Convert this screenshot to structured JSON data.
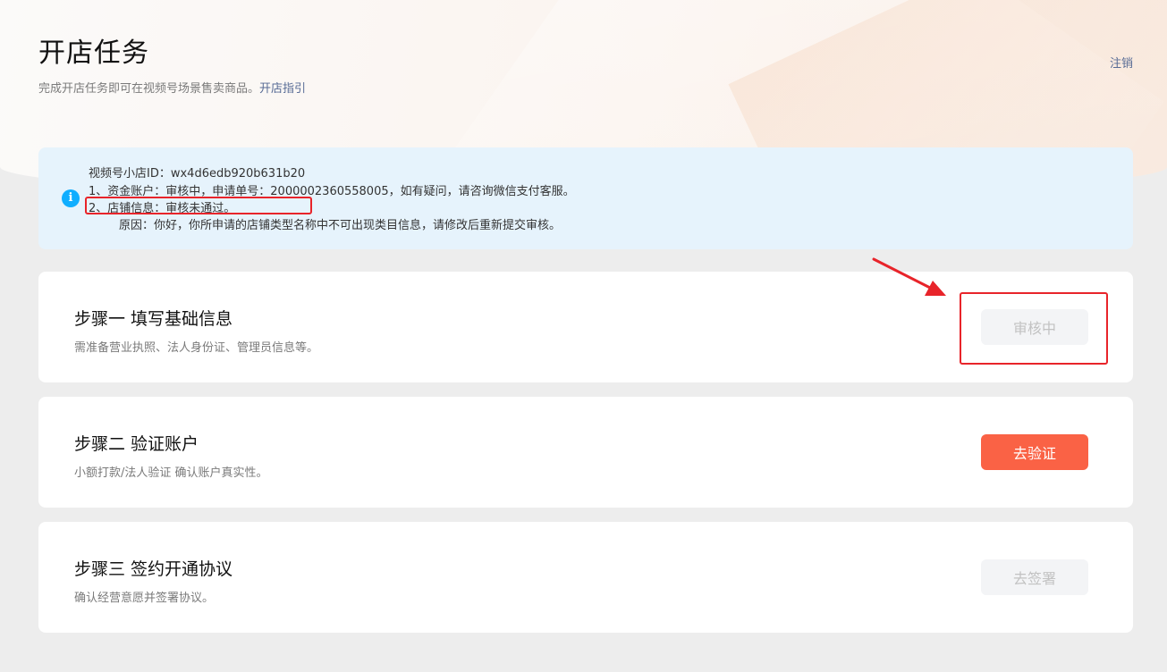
{
  "header": {
    "title": "开店任务",
    "subtitle": "完成开店任务即可在视频号场景售卖商品。",
    "guide_link": "开店指引",
    "logout": "注销"
  },
  "notice": {
    "shop_id_line": "视频号小店ID：wx4d6edb920b631b20",
    "line1": "1、资金账户：审核中，申请单号：2000002360558005，如有疑问，请咨询微信支付客服。",
    "line2": "2、店铺信息：审核未通过。",
    "line3": "原因：你好，你所申请的店铺类型名称中不可出现类目信息，请修改后重新提交审核。",
    "icon": "info-icon"
  },
  "steps": [
    {
      "title": "步骤一 填写基础信息",
      "desc": "需准备营业执照、法人身份证、管理员信息等。",
      "button": "审核中",
      "state": "disabled"
    },
    {
      "title": "步骤二 验证账户",
      "desc": "小额打款/法人验证 确认账户真实性。",
      "button": "去验证",
      "state": "primary"
    },
    {
      "title": "步骤三 签约开通协议",
      "desc": "确认经营意愿并签署协议。",
      "button": "去签署",
      "state": "disabled"
    }
  ],
  "colors": {
    "primary": "#fa6245",
    "link": "#576b95",
    "annotation": "#e8242a",
    "info": "#10aeff"
  }
}
